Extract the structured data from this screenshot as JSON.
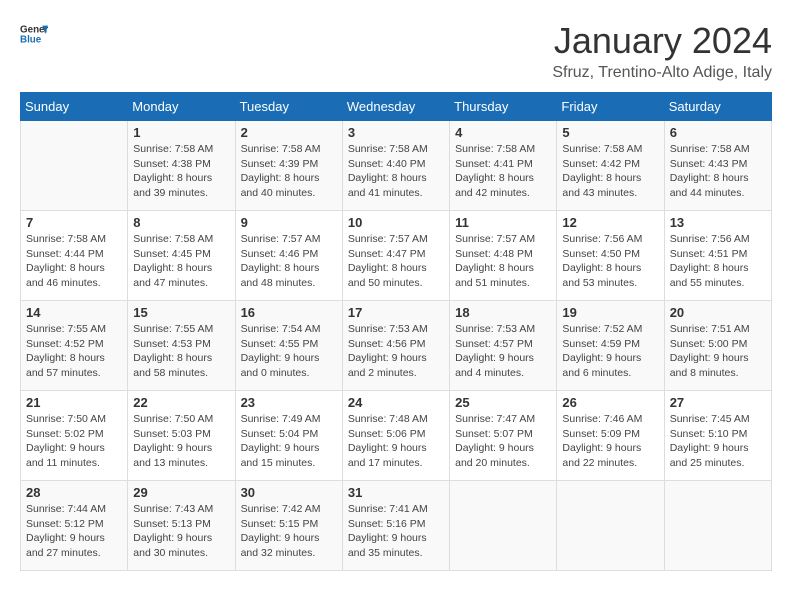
{
  "header": {
    "logo_general": "General",
    "logo_blue": "Blue",
    "month_title": "January 2024",
    "location": "Sfruz, Trentino-Alto Adige, Italy"
  },
  "weekdays": [
    "Sunday",
    "Monday",
    "Tuesday",
    "Wednesday",
    "Thursday",
    "Friday",
    "Saturday"
  ],
  "weeks": [
    [
      {
        "day": "",
        "sunrise": "",
        "sunset": "",
        "daylight": ""
      },
      {
        "day": "1",
        "sunrise": "Sunrise: 7:58 AM",
        "sunset": "Sunset: 4:38 PM",
        "daylight": "Daylight: 8 hours and 39 minutes."
      },
      {
        "day": "2",
        "sunrise": "Sunrise: 7:58 AM",
        "sunset": "Sunset: 4:39 PM",
        "daylight": "Daylight: 8 hours and 40 minutes."
      },
      {
        "day": "3",
        "sunrise": "Sunrise: 7:58 AM",
        "sunset": "Sunset: 4:40 PM",
        "daylight": "Daylight: 8 hours and 41 minutes."
      },
      {
        "day": "4",
        "sunrise": "Sunrise: 7:58 AM",
        "sunset": "Sunset: 4:41 PM",
        "daylight": "Daylight: 8 hours and 42 minutes."
      },
      {
        "day": "5",
        "sunrise": "Sunrise: 7:58 AM",
        "sunset": "Sunset: 4:42 PM",
        "daylight": "Daylight: 8 hours and 43 minutes."
      },
      {
        "day": "6",
        "sunrise": "Sunrise: 7:58 AM",
        "sunset": "Sunset: 4:43 PM",
        "daylight": "Daylight: 8 hours and 44 minutes."
      }
    ],
    [
      {
        "day": "7",
        "sunrise": "Sunrise: 7:58 AM",
        "sunset": "Sunset: 4:44 PM",
        "daylight": "Daylight: 8 hours and 46 minutes."
      },
      {
        "day": "8",
        "sunrise": "Sunrise: 7:58 AM",
        "sunset": "Sunset: 4:45 PM",
        "daylight": "Daylight: 8 hours and 47 minutes."
      },
      {
        "day": "9",
        "sunrise": "Sunrise: 7:57 AM",
        "sunset": "Sunset: 4:46 PM",
        "daylight": "Daylight: 8 hours and 48 minutes."
      },
      {
        "day": "10",
        "sunrise": "Sunrise: 7:57 AM",
        "sunset": "Sunset: 4:47 PM",
        "daylight": "Daylight: 8 hours and 50 minutes."
      },
      {
        "day": "11",
        "sunrise": "Sunrise: 7:57 AM",
        "sunset": "Sunset: 4:48 PM",
        "daylight": "Daylight: 8 hours and 51 minutes."
      },
      {
        "day": "12",
        "sunrise": "Sunrise: 7:56 AM",
        "sunset": "Sunset: 4:50 PM",
        "daylight": "Daylight: 8 hours and 53 minutes."
      },
      {
        "day": "13",
        "sunrise": "Sunrise: 7:56 AM",
        "sunset": "Sunset: 4:51 PM",
        "daylight": "Daylight: 8 hours and 55 minutes."
      }
    ],
    [
      {
        "day": "14",
        "sunrise": "Sunrise: 7:55 AM",
        "sunset": "Sunset: 4:52 PM",
        "daylight": "Daylight: 8 hours and 57 minutes."
      },
      {
        "day": "15",
        "sunrise": "Sunrise: 7:55 AM",
        "sunset": "Sunset: 4:53 PM",
        "daylight": "Daylight: 8 hours and 58 minutes."
      },
      {
        "day": "16",
        "sunrise": "Sunrise: 7:54 AM",
        "sunset": "Sunset: 4:55 PM",
        "daylight": "Daylight: 9 hours and 0 minutes."
      },
      {
        "day": "17",
        "sunrise": "Sunrise: 7:53 AM",
        "sunset": "Sunset: 4:56 PM",
        "daylight": "Daylight: 9 hours and 2 minutes."
      },
      {
        "day": "18",
        "sunrise": "Sunrise: 7:53 AM",
        "sunset": "Sunset: 4:57 PM",
        "daylight": "Daylight: 9 hours and 4 minutes."
      },
      {
        "day": "19",
        "sunrise": "Sunrise: 7:52 AM",
        "sunset": "Sunset: 4:59 PM",
        "daylight": "Daylight: 9 hours and 6 minutes."
      },
      {
        "day": "20",
        "sunrise": "Sunrise: 7:51 AM",
        "sunset": "Sunset: 5:00 PM",
        "daylight": "Daylight: 9 hours and 8 minutes."
      }
    ],
    [
      {
        "day": "21",
        "sunrise": "Sunrise: 7:50 AM",
        "sunset": "Sunset: 5:02 PM",
        "daylight": "Daylight: 9 hours and 11 minutes."
      },
      {
        "day": "22",
        "sunrise": "Sunrise: 7:50 AM",
        "sunset": "Sunset: 5:03 PM",
        "daylight": "Daylight: 9 hours and 13 minutes."
      },
      {
        "day": "23",
        "sunrise": "Sunrise: 7:49 AM",
        "sunset": "Sunset: 5:04 PM",
        "daylight": "Daylight: 9 hours and 15 minutes."
      },
      {
        "day": "24",
        "sunrise": "Sunrise: 7:48 AM",
        "sunset": "Sunset: 5:06 PM",
        "daylight": "Daylight: 9 hours and 17 minutes."
      },
      {
        "day": "25",
        "sunrise": "Sunrise: 7:47 AM",
        "sunset": "Sunset: 5:07 PM",
        "daylight": "Daylight: 9 hours and 20 minutes."
      },
      {
        "day": "26",
        "sunrise": "Sunrise: 7:46 AM",
        "sunset": "Sunset: 5:09 PM",
        "daylight": "Daylight: 9 hours and 22 minutes."
      },
      {
        "day": "27",
        "sunrise": "Sunrise: 7:45 AM",
        "sunset": "Sunset: 5:10 PM",
        "daylight": "Daylight: 9 hours and 25 minutes."
      }
    ],
    [
      {
        "day": "28",
        "sunrise": "Sunrise: 7:44 AM",
        "sunset": "Sunset: 5:12 PM",
        "daylight": "Daylight: 9 hours and 27 minutes."
      },
      {
        "day": "29",
        "sunrise": "Sunrise: 7:43 AM",
        "sunset": "Sunset: 5:13 PM",
        "daylight": "Daylight: 9 hours and 30 minutes."
      },
      {
        "day": "30",
        "sunrise": "Sunrise: 7:42 AM",
        "sunset": "Sunset: 5:15 PM",
        "daylight": "Daylight: 9 hours and 32 minutes."
      },
      {
        "day": "31",
        "sunrise": "Sunrise: 7:41 AM",
        "sunset": "Sunset: 5:16 PM",
        "daylight": "Daylight: 9 hours and 35 minutes."
      },
      {
        "day": "",
        "sunrise": "",
        "sunset": "",
        "daylight": ""
      },
      {
        "day": "",
        "sunrise": "",
        "sunset": "",
        "daylight": ""
      },
      {
        "day": "",
        "sunrise": "",
        "sunset": "",
        "daylight": ""
      }
    ]
  ]
}
